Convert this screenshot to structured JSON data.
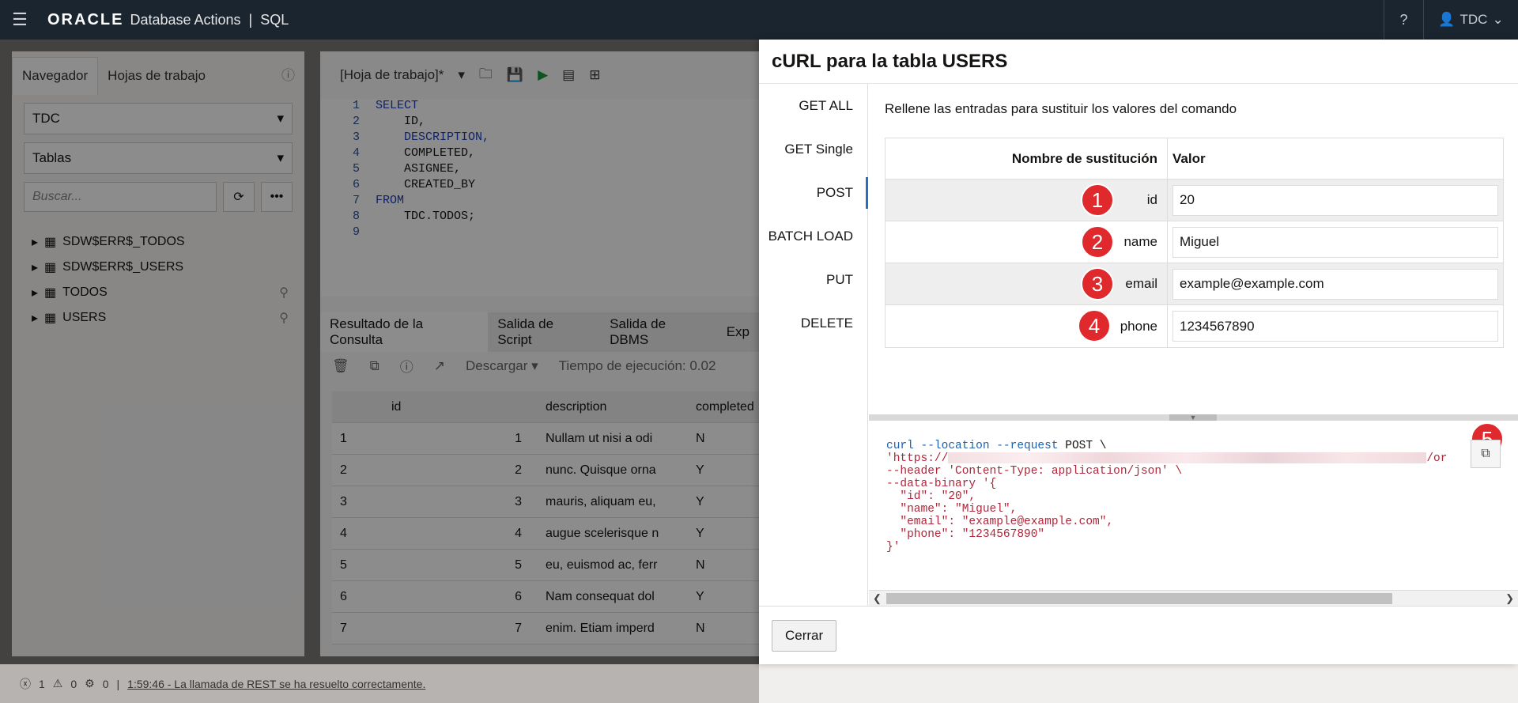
{
  "topbar": {
    "brand": "ORACLE",
    "app": "Database Actions",
    "separator": "|",
    "section": "SQL",
    "user": "TDC"
  },
  "navigator": {
    "tabs": [
      "Navegador",
      "Hojas de trabajo"
    ],
    "schema": "TDC",
    "object_type": "Tablas",
    "search_placeholder": "Buscar...",
    "items": [
      "SDW$ERR$_TODOS",
      "SDW$ERR$_USERS",
      "TODOS",
      "USERS"
    ]
  },
  "worksheet": {
    "tab_label": "[Hoja de trabajo]*",
    "code_lines": [
      {
        "n": "1",
        "text": "SELECT"
      },
      {
        "n": "2",
        "text": "    ID,"
      },
      {
        "n": "3",
        "text": "    DESCRIPTION,"
      },
      {
        "n": "4",
        "text": "    COMPLETED,"
      },
      {
        "n": "5",
        "text": "    ASIGNEE,"
      },
      {
        "n": "6",
        "text": "    CREATED_BY"
      },
      {
        "n": "7",
        "text": "FROM"
      },
      {
        "n": "8",
        "text": "    TDC.TODOS;"
      },
      {
        "n": "9",
        "text": ""
      }
    ],
    "result_tabs": [
      "Resultado de la Consulta",
      "Salida de Script",
      "Salida de DBMS",
      "Exp"
    ],
    "download": "Descargar",
    "exec_time": "Tiempo de ejecución: 0.02",
    "columns": [
      "",
      "id",
      "description",
      "completed"
    ],
    "rows": [
      [
        "1",
        "1",
        "Nullam ut nisi a odi",
        "N"
      ],
      [
        "2",
        "2",
        "nunc. Quisque orna",
        "Y"
      ],
      [
        "3",
        "3",
        "mauris, aliquam eu,",
        "Y"
      ],
      [
        "4",
        "4",
        "augue scelerisque n",
        "Y"
      ],
      [
        "5",
        "5",
        "eu, euismod ac, ferr",
        "N"
      ],
      [
        "6",
        "6",
        "Nam consequat dol",
        "Y"
      ],
      [
        "7",
        "7",
        "enim. Etiam imperd",
        "N"
      ]
    ]
  },
  "statusbar": {
    "errors": "1",
    "warnings": "0",
    "settings": "0",
    "message": "1:59:46 - La llamada de REST se ha resuelto correctamente."
  },
  "modal": {
    "title": "cURL para la tabla USERS",
    "methods": [
      "GET ALL",
      "GET Single",
      "POST",
      "BATCH LOAD",
      "PUT",
      "DELETE"
    ],
    "active_method": "POST",
    "instructions": "Rellene las entradas para sustituir los valores del comando",
    "table_headers": [
      "Nombre de sustitución",
      "Valor"
    ],
    "params": [
      {
        "badge": "1",
        "name": "id",
        "value": "20"
      },
      {
        "badge": "2",
        "name": "name",
        "value": "Miguel"
      },
      {
        "badge": "3",
        "name": "email",
        "value": "example@example.com"
      },
      {
        "badge": "4",
        "name": "phone",
        "value": "1234567890"
      }
    ],
    "copy_badge": "5",
    "curl": {
      "l1_cmd": "curl --location --request",
      "l1_method": "POST \\",
      "l2_prefix": "'https://",
      "l2_suffix": "/or",
      "l3": "--header 'Content-Type: application/json' \\",
      "l4": "--data-binary '{",
      "l5": "  \"id\": \"20\",",
      "l6": "  \"name\": \"Miguel\",",
      "l7": "  \"email\": \"example@example.com\",",
      "l8": "  \"phone\": \"1234567890\"",
      "l9": "}'"
    },
    "close_label": "Cerrar"
  },
  "colors": {
    "topbar": "#1b2530",
    "badge": "#e0292c",
    "accent": "#2a6ebf",
    "curl_keyword": "#1f5fb0",
    "curl_string": "#b0263a"
  }
}
